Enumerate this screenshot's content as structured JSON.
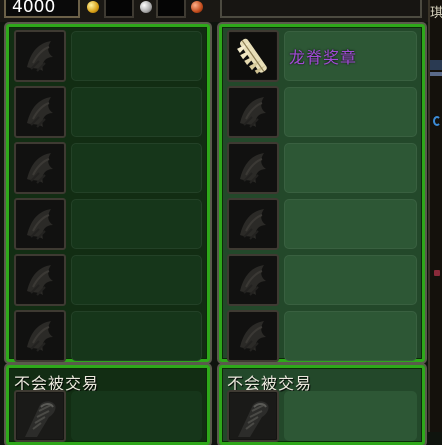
{
  "topbar": {
    "gold_amount": "4000",
    "currency_icons": [
      "gold-coin-icon",
      "silver-coin-icon",
      "copper-coin-icon"
    ]
  },
  "left_panel": {
    "slots": [
      "empty",
      "empty",
      "empty",
      "empty",
      "empty",
      "empty"
    ]
  },
  "right_panel": {
    "first_item": {
      "name": "龙脊奖章",
      "icon": "dragon-spine-medal-icon",
      "name_color": "#a24bd6"
    },
    "slots": [
      "item",
      "empty",
      "empty",
      "empty",
      "empty",
      "empty"
    ]
  },
  "bottom_left": {
    "label": "不会被交易",
    "icon": "bracer-icon"
  },
  "bottom_right": {
    "label": "不会被交易",
    "icon": "bracer-icon"
  },
  "edge": {
    "glyph": "琪"
  },
  "colors": {
    "border_green": "#2ea81a",
    "item_purple": "#a24bd6"
  }
}
